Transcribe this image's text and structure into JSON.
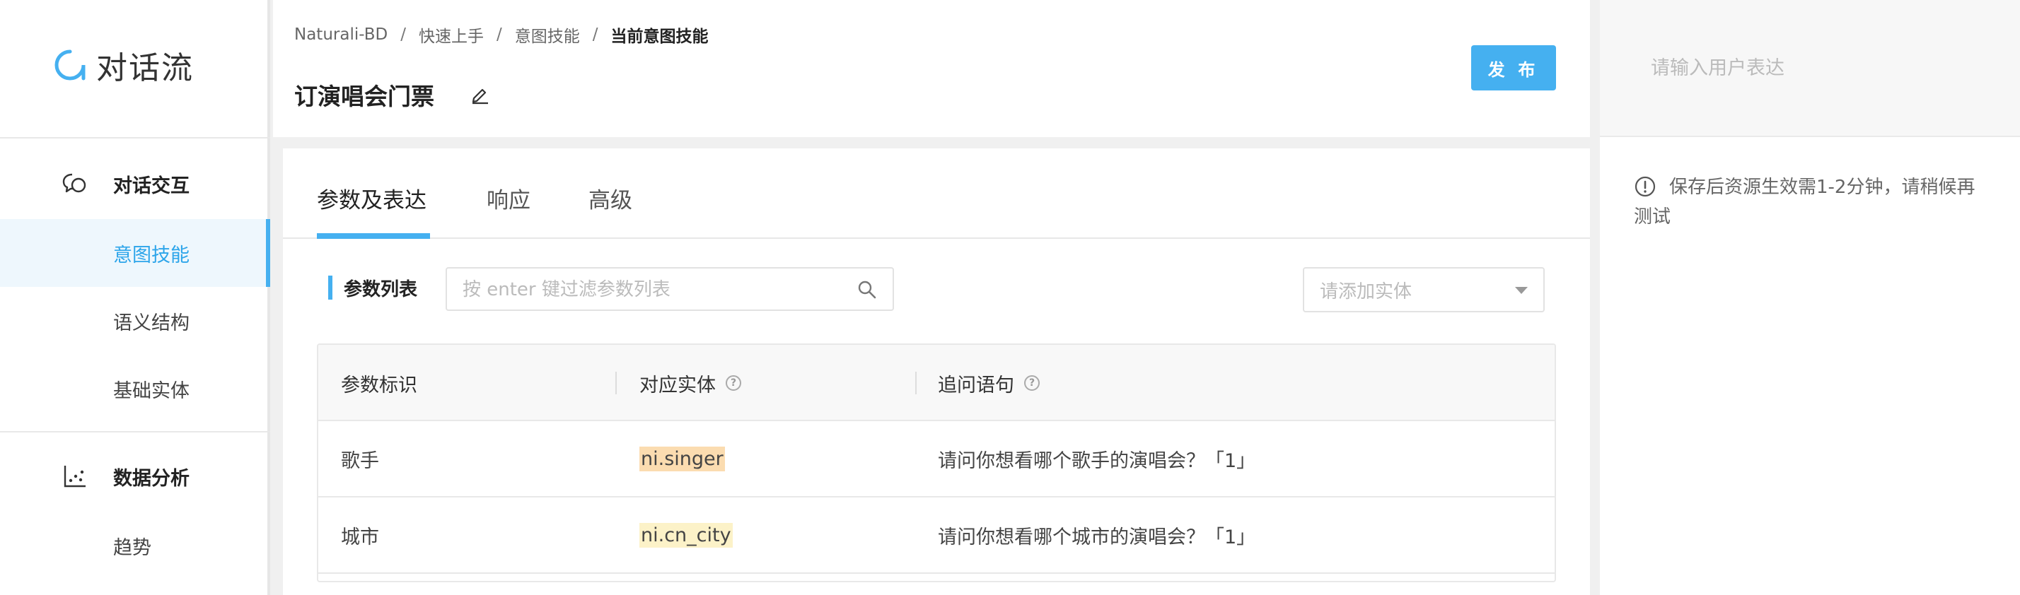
{
  "app": {
    "title": "对话流"
  },
  "sidebar": {
    "sections": [
      {
        "title": "对话交互",
        "icon": "chat-bubbles-icon",
        "items": [
          "意图技能",
          "语义结构",
          "基础实体"
        ]
      },
      {
        "title": "数据分析",
        "icon": "scatter-plot-icon",
        "items": [
          "趋势"
        ]
      }
    ],
    "active_item": "意图技能"
  },
  "header": {
    "breadcrumb": [
      "Naturali-BD",
      "快速上手",
      "意图技能",
      "当前意图技能"
    ],
    "separator": "/",
    "title": "订演唱会门票",
    "publish_label": "发 布"
  },
  "tabs": [
    "参数及表达",
    "响应",
    "高级"
  ],
  "params": {
    "label": "参数列表",
    "search_placeholder": "按 enter 键过滤参数列表",
    "entity_placeholder": "请添加实体",
    "columns": [
      "参数标识",
      "对应实体",
      "追问语句"
    ],
    "rows": [
      {
        "name": "歌手",
        "entity": "ni.singer",
        "question": "请问你想看哪个歌手的演唱会？「1」"
      },
      {
        "name": "城市",
        "entity": "ni.cn_city",
        "question": "请问你想看哪个城市的演唱会？「1」"
      }
    ]
  },
  "test_panel": {
    "input_placeholder": "请输入用户表达",
    "notice": "保存后资源生效需1-2分钟，请稍候再测试"
  },
  "colors": {
    "accent": "#45b0f0",
    "singer_tag": "#fbdcb0",
    "city_tag": "#fcf2c8"
  }
}
